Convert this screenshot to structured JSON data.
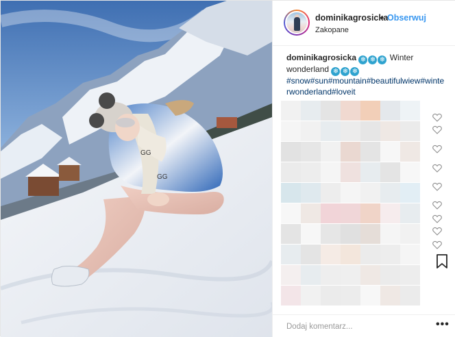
{
  "post": {
    "username": "dominikagrosicka",
    "dot": "•",
    "follow_label": "Obserwuj",
    "location": "Zakopane",
    "caption_username": "dominikagrosicka",
    "caption_text_1": "Winter",
    "caption_text_2": "wonderland",
    "hashtags": "#snow#sun#mountain#beautifulwiew#winterwonderland#loveit",
    "comment_placeholder": "Dodaj komentarz...",
    "more_label": "•••"
  },
  "icons": {
    "snowflake": "snowflake-emoji-icon",
    "heart": "heart-outline-icon",
    "bookmark": "bookmark-outline-icon",
    "more": "more-options-icon"
  },
  "colors": {
    "link": "#3897f0",
    "hashtag": "#003569",
    "text": "#262626",
    "placeholder": "#999999"
  }
}
